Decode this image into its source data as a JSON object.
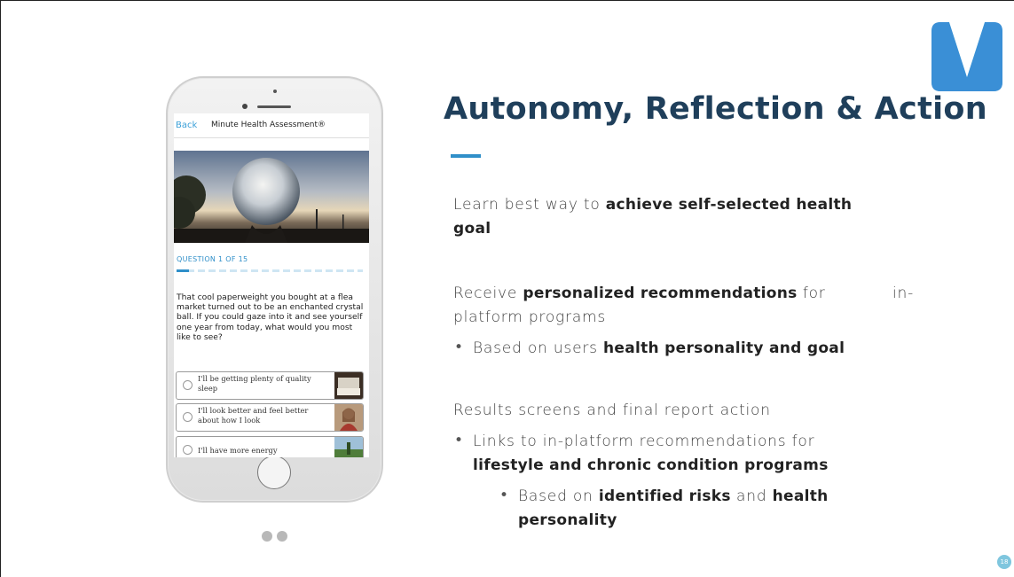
{
  "slide": {
    "title": "Autonomy, Reflection & Action",
    "page_number": "18",
    "accent_color": "#2f8fc9",
    "title_color": "#1f3f5b"
  },
  "logo": {
    "icon": "v-logo-icon",
    "colors": [
      "#6bd4e0",
      "#3a8fd6"
    ]
  },
  "content": {
    "p1_plain": "Learn best way to ",
    "p1_bold": "achieve self-selected health",
    "p1_bold_2": "goal",
    "p2_plain_a": "Receive ",
    "p2_bold": "personalized recommendations",
    "p2_plain_b": " for",
    "p2_plain_c": "in-",
    "p2_line2": "platform programs",
    "b1_plain": "Based on users ",
    "b1_bold": "health personality and goal",
    "p3": "Results screens and final report action",
    "b2_plain": "Links to in-platform recommendations for",
    "b2_bold": "lifestyle and chronic condition programs",
    "b3_plain_a": "Based on ",
    "b3_bold_a": "identified risks",
    "b3_plain_b": " and ",
    "b3_bold_b": "health",
    "b3_bold_c": "personality",
    "bullet_char": "•"
  },
  "phone": {
    "nav_back": "Back",
    "nav_title": "Minute Health Assessment®",
    "question_label": "QUESTION 1 OF 15",
    "progress": {
      "current": 1,
      "total": 15
    },
    "question_text": "That cool paperweight you bought at a flea market turned out to be an enchanted crystal ball. If you could gaze into it and see yourself one year from today, what would you most like to see?",
    "options": [
      {
        "label": "I'll be getting plenty of quality sleep"
      },
      {
        "label": "I'll look better and feel better about how I look"
      },
      {
        "label": "I'll have more energy"
      }
    ]
  },
  "pager": {
    "dots": 2
  }
}
